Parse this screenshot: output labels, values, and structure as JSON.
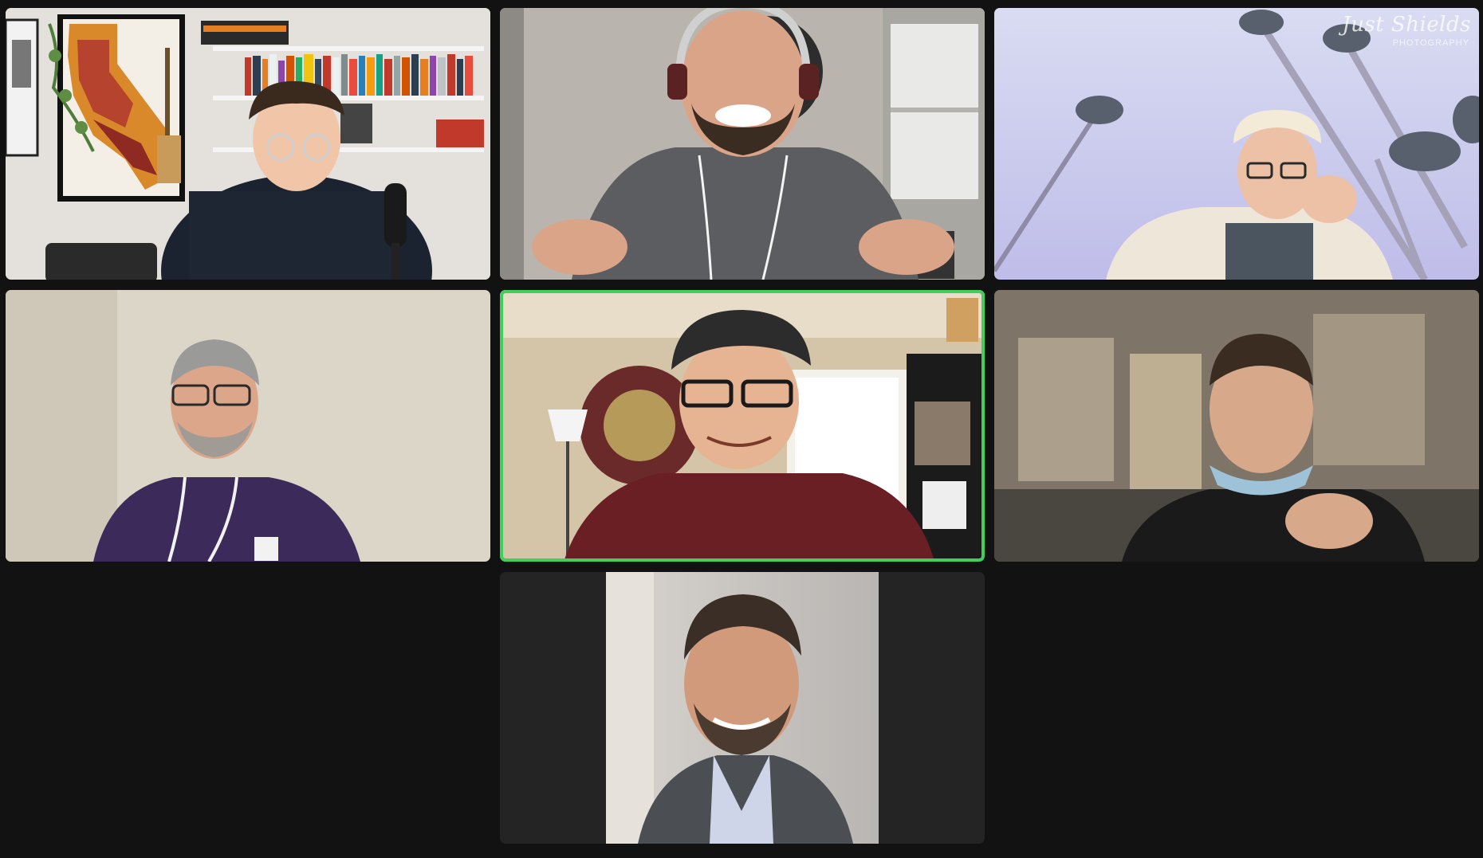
{
  "app": {
    "view": "gallery",
    "active_speaker_color": "#3fcf5a",
    "background_color": "#121212"
  },
  "participants": [
    {
      "video_on": true,
      "scene": "studio with California map poster, bookshelf and microphone"
    },
    {
      "video_on": true,
      "scene": "bearded man with headphones smiling"
    },
    {
      "video_on": true,
      "scene": "palm trees virtual background",
      "watermark": {
        "title": "Just Shields",
        "subtitle": "PHOTOGRAPHY"
      }
    },
    {
      "video_on": true,
      "scene": "man in purple hoodie with glasses"
    },
    {
      "video_on": true,
      "active_speaker": true,
      "scene": "man in cap and glasses, gong and lamp behind"
    },
    {
      "video_on": true,
      "scene": "man with mask on chin, blurred background"
    },
    {
      "video_on": false,
      "profile_photo": true,
      "scene": "profile portrait in blazer"
    }
  ]
}
